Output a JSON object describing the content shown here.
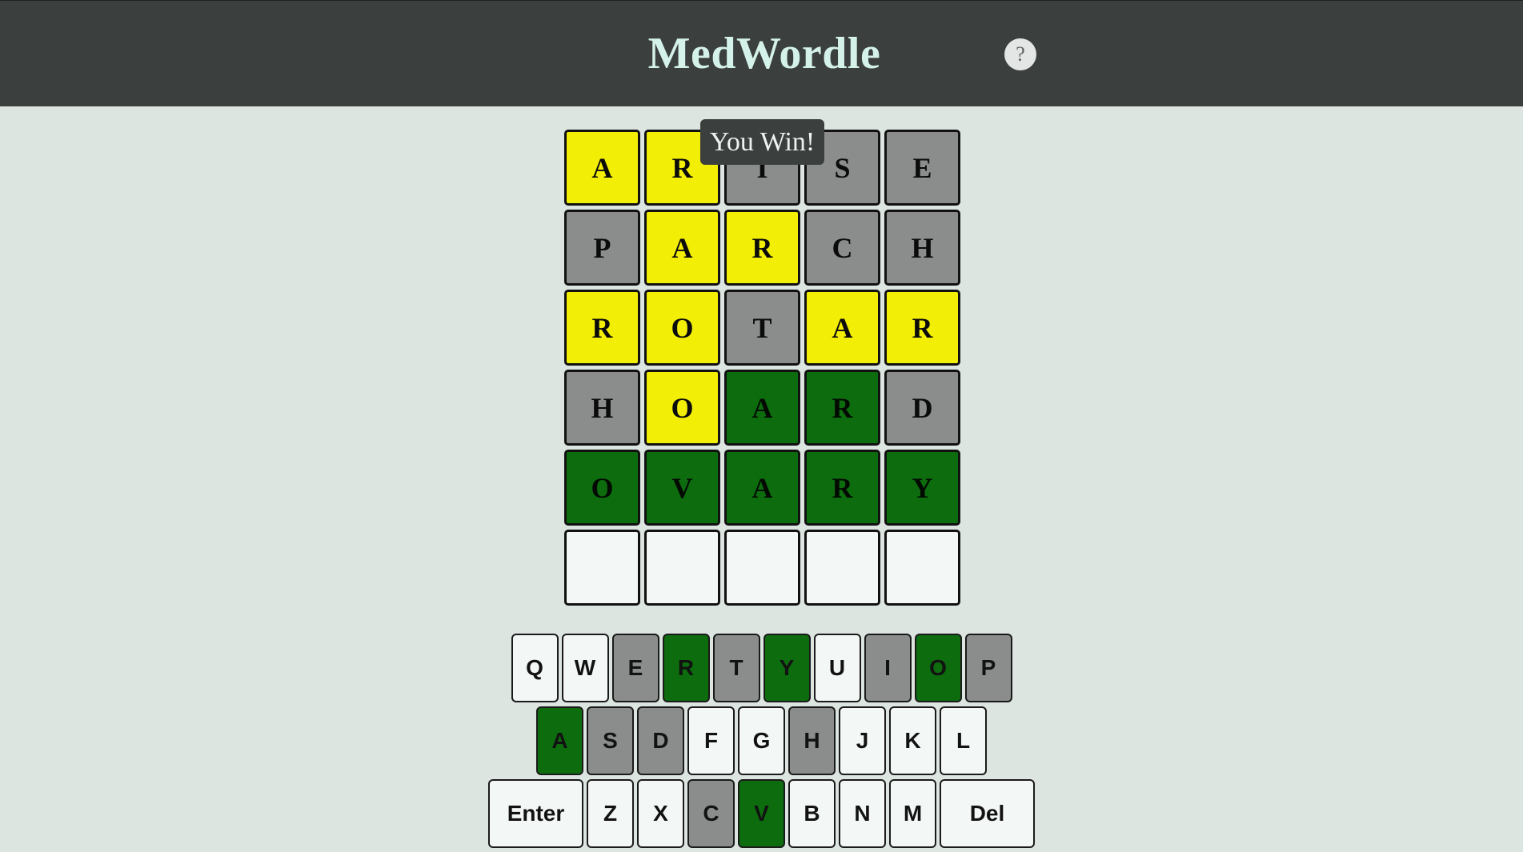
{
  "header": {
    "title": "MedWordle",
    "help_label": "?"
  },
  "toast": {
    "text": "You Win!"
  },
  "colors": {
    "present": "#f3ee05",
    "absent": "#8a8d8c",
    "correct": "#0d6c0e",
    "empty": "#f3f7f5",
    "header_bg": "#3b3f3e",
    "page_bg": "#dde5e1"
  },
  "board": {
    "rows": [
      [
        {
          "letter": "A",
          "state": "present"
        },
        {
          "letter": "R",
          "state": "present"
        },
        {
          "letter": "I",
          "state": "absent"
        },
        {
          "letter": "S",
          "state": "absent"
        },
        {
          "letter": "E",
          "state": "absent"
        }
      ],
      [
        {
          "letter": "P",
          "state": "absent"
        },
        {
          "letter": "A",
          "state": "present"
        },
        {
          "letter": "R",
          "state": "present"
        },
        {
          "letter": "C",
          "state": "absent"
        },
        {
          "letter": "H",
          "state": "absent"
        }
      ],
      [
        {
          "letter": "R",
          "state": "present"
        },
        {
          "letter": "O",
          "state": "present"
        },
        {
          "letter": "T",
          "state": "absent"
        },
        {
          "letter": "A",
          "state": "present"
        },
        {
          "letter": "R",
          "state": "present"
        }
      ],
      [
        {
          "letter": "H",
          "state": "absent"
        },
        {
          "letter": "O",
          "state": "present"
        },
        {
          "letter": "A",
          "state": "correct"
        },
        {
          "letter": "R",
          "state": "correct"
        },
        {
          "letter": "D",
          "state": "absent"
        }
      ],
      [
        {
          "letter": "O",
          "state": "correct"
        },
        {
          "letter": "V",
          "state": "correct"
        },
        {
          "letter": "A",
          "state": "correct"
        },
        {
          "letter": "R",
          "state": "correct"
        },
        {
          "letter": "Y",
          "state": "correct"
        }
      ],
      [
        {
          "letter": "",
          "state": "empty"
        },
        {
          "letter": "",
          "state": "empty"
        },
        {
          "letter": "",
          "state": "empty"
        },
        {
          "letter": "",
          "state": "empty"
        },
        {
          "letter": "",
          "state": "empty"
        }
      ]
    ]
  },
  "keyboard": {
    "rows": [
      [
        {
          "label": "Q",
          "state": "unused"
        },
        {
          "label": "W",
          "state": "unused"
        },
        {
          "label": "E",
          "state": "absent"
        },
        {
          "label": "R",
          "state": "correct"
        },
        {
          "label": "T",
          "state": "absent"
        },
        {
          "label": "Y",
          "state": "correct"
        },
        {
          "label": "U",
          "state": "unused"
        },
        {
          "label": "I",
          "state": "absent"
        },
        {
          "label": "O",
          "state": "correct"
        },
        {
          "label": "P",
          "state": "absent"
        }
      ],
      [
        {
          "label": "A",
          "state": "correct"
        },
        {
          "label": "S",
          "state": "absent"
        },
        {
          "label": "D",
          "state": "absent"
        },
        {
          "label": "F",
          "state": "unused"
        },
        {
          "label": "G",
          "state": "unused"
        },
        {
          "label": "H",
          "state": "absent"
        },
        {
          "label": "J",
          "state": "unused"
        },
        {
          "label": "K",
          "state": "unused"
        },
        {
          "label": "L",
          "state": "unused"
        }
      ],
      [
        {
          "label": "Enter",
          "state": "unused",
          "wide": true
        },
        {
          "label": "Z",
          "state": "unused"
        },
        {
          "label": "X",
          "state": "unused"
        },
        {
          "label": "C",
          "state": "absent"
        },
        {
          "label": "V",
          "state": "correct"
        },
        {
          "label": "B",
          "state": "unused"
        },
        {
          "label": "N",
          "state": "unused"
        },
        {
          "label": "M",
          "state": "unused"
        },
        {
          "label": "Del",
          "state": "unused",
          "wide": true
        }
      ]
    ]
  }
}
